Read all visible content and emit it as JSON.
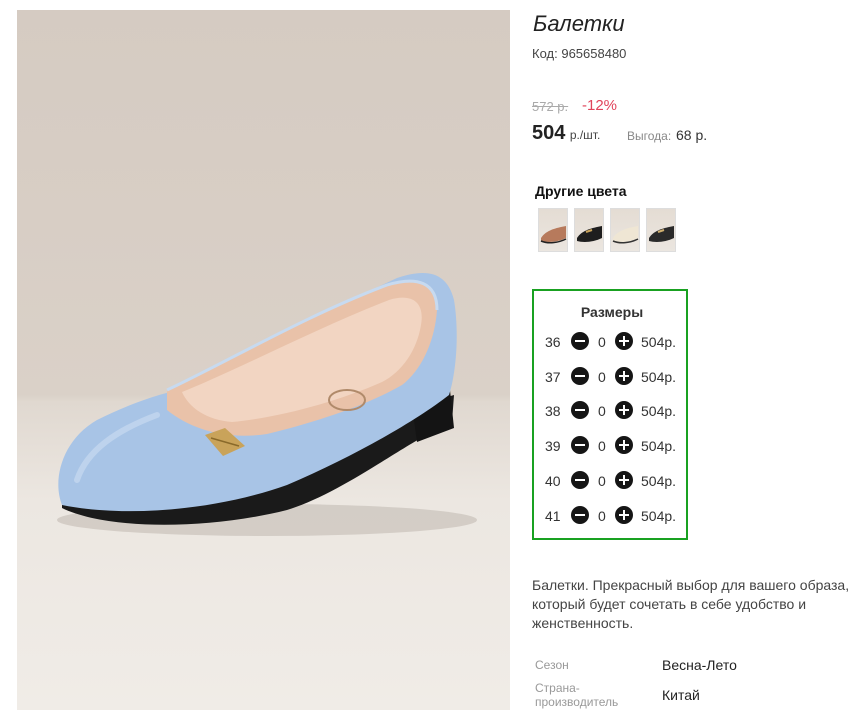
{
  "product": {
    "title": "Балетки",
    "code_label": "Код:",
    "code": "965658480",
    "old_price": "572 р.",
    "discount": "-12%",
    "price": "504",
    "price_unit": "р./шт.",
    "benefit_label": "Выгода:",
    "benefit_value": "68 р.",
    "main_color": "#a8c4e6"
  },
  "other_colors": {
    "title": "Другие цвета",
    "swatches": [
      {
        "name": "brown",
        "color": "#b77a5c"
      },
      {
        "name": "black",
        "color": "#1e1e1e"
      },
      {
        "name": "beige",
        "color": "#efe6d4"
      },
      {
        "name": "black-gold",
        "color": "#2a2a2a"
      }
    ]
  },
  "sizes": {
    "title": "Размеры",
    "rows": [
      {
        "size": "36",
        "qty": "0",
        "price": "504р."
      },
      {
        "size": "37",
        "qty": "0",
        "price": "504р."
      },
      {
        "size": "38",
        "qty": "0",
        "price": "504р."
      },
      {
        "size": "39",
        "qty": "0",
        "price": "504р."
      },
      {
        "size": "40",
        "qty": "0",
        "price": "504р."
      },
      {
        "size": "41",
        "qty": "0",
        "price": "504р."
      }
    ],
    "border_color": "#19a121"
  },
  "description": "Балетки. Прекрасный выбор для вашего образа, который будет сочетать в себе удобство и женственность.",
  "properties": [
    {
      "label": "Сезон",
      "value": "Весна-Лето"
    },
    {
      "label": "Страна-производитель",
      "value": "Китай"
    }
  ]
}
